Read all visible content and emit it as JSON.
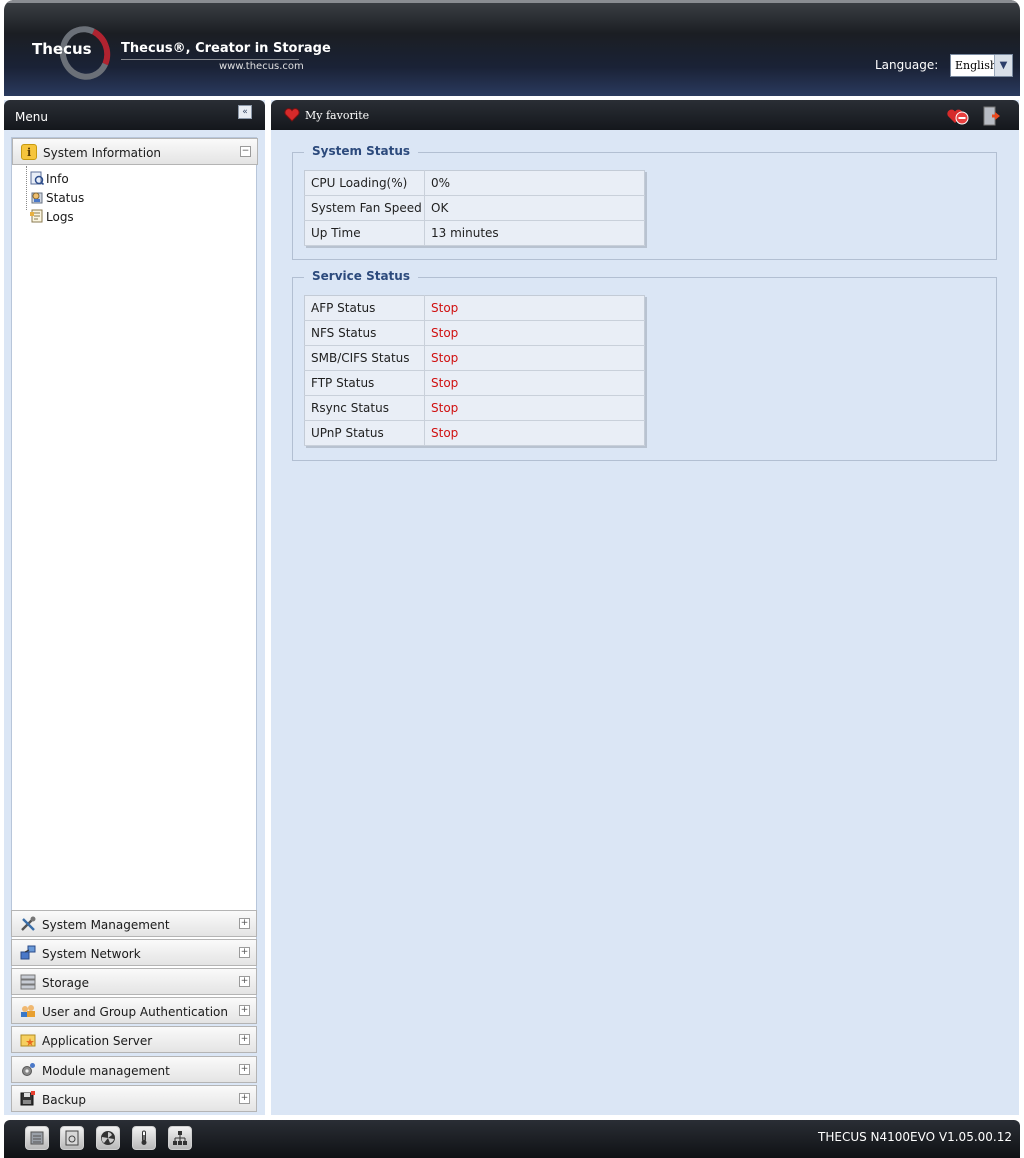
{
  "header": {
    "logo_text": "Thecus",
    "tagline": "Thecus®, Creator in Storage",
    "website": "www.thecus.com",
    "language_label": "Language:",
    "language_value": "English"
  },
  "sidebar": {
    "title": "Menu",
    "sections": [
      {
        "label": "System Information",
        "expanded": true,
        "icon": "info-icon"
      },
      {
        "label": "System Management",
        "icon": "tools-icon"
      },
      {
        "label": "System Network",
        "icon": "network-icon"
      },
      {
        "label": "Storage",
        "icon": "storage-icon"
      },
      {
        "label": "User and Group Authentication",
        "icon": "users-icon"
      },
      {
        "label": "Application Server",
        "icon": "app-server-icon"
      },
      {
        "label": "Module management",
        "icon": "module-icon"
      },
      {
        "label": "Backup",
        "icon": "backup-icon"
      }
    ],
    "items": [
      {
        "label": "Info",
        "icon": "info-page-icon"
      },
      {
        "label": "Status",
        "icon": "status-icon"
      },
      {
        "label": "Logs",
        "icon": "logs-icon"
      }
    ]
  },
  "favorites": {
    "label": "My favorite"
  },
  "system_status": {
    "title": "System Status",
    "rows": [
      {
        "key": "CPU Loading(%)",
        "value": "0%"
      },
      {
        "key": "System Fan Speed",
        "value": "OK"
      },
      {
        "key": "Up Time",
        "value": "13 minutes"
      }
    ]
  },
  "service_status": {
    "title": "Service Status",
    "rows": [
      {
        "key": "AFP Status",
        "value": "Stop"
      },
      {
        "key": "NFS Status",
        "value": "Stop"
      },
      {
        "key": "SMB/CIFS Status",
        "value": "Stop"
      },
      {
        "key": "FTP Status",
        "value": "Stop"
      },
      {
        "key": "Rsync Status",
        "value": "Stop"
      },
      {
        "key": "UPnP Status",
        "value": "Stop"
      }
    ]
  },
  "footer": {
    "icons": [
      "cpu-icon",
      "disk-icon",
      "fan-icon",
      "temperature-icon",
      "network-status-icon"
    ],
    "version": "THECUS N4100EVO V1.05.00.12"
  },
  "colors": {
    "accent": "#2c4a7c",
    "stop": "#d01010",
    "panel_bg": "#dbe6f5"
  }
}
